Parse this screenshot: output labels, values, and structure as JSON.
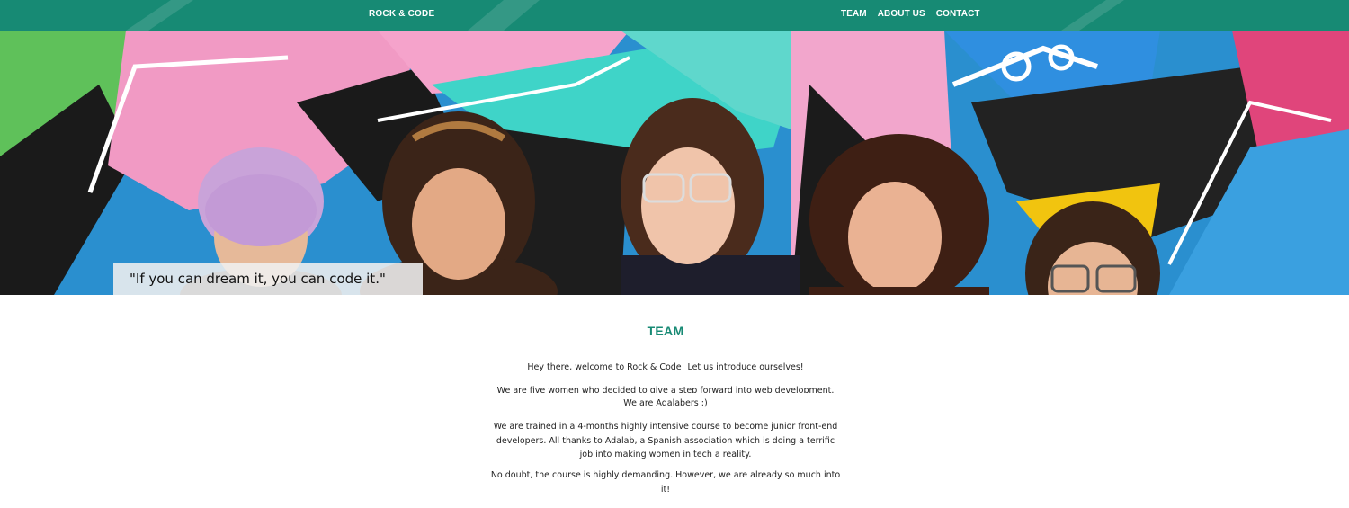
{
  "header": {
    "brand": "ROCK & CODE",
    "nav": [
      "TEAM",
      "ABOUT US",
      "CONTACT"
    ]
  },
  "hero": {
    "quote": "\"If you can dream it, you can code it.\""
  },
  "team": {
    "title": "TEAM",
    "paragraphs": [
      "Hey there, welcome to Rock & Code! Let us introduce ourselves!",
      "We are five women who decided to give a step forward into web development.",
      "We are Adalabers :)",
      "We are trained in a 4-months highly intensive course to become junior front-end developers. All thanks to Adalab, a Spanish association which is doing a terrific job into making women in tech a reality.",
      "No doubt, the course is highly demanding. However, we are already so much into it!"
    ]
  },
  "colors": {
    "brand_green": "#178a74",
    "header_text": "#ffffff",
    "quote_box": "#f0f0f0"
  }
}
